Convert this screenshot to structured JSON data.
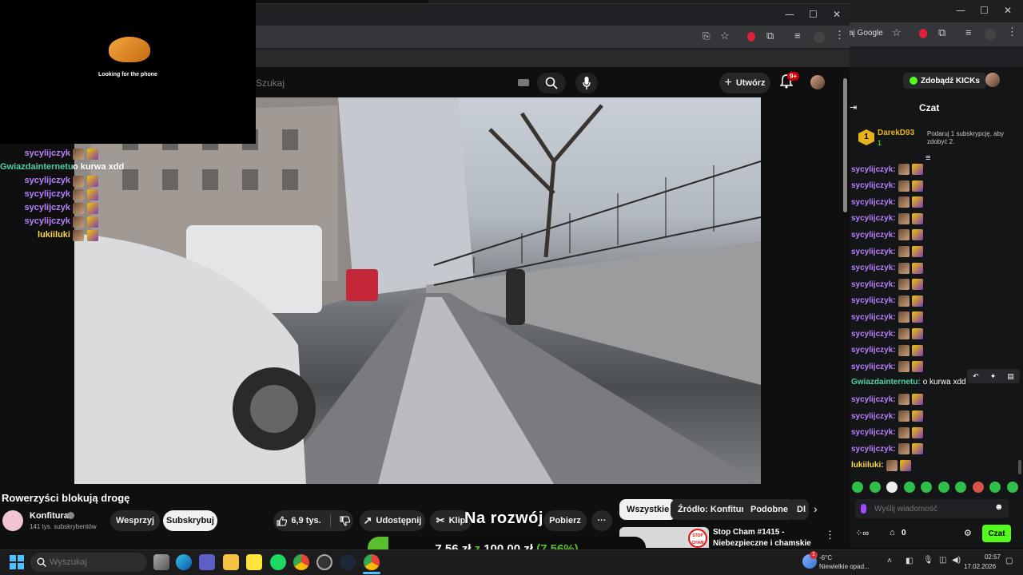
{
  "overlay": {
    "caption": "Looking for the phone"
  },
  "back_window": {
    "address_text": "aj Google"
  },
  "youtube": {
    "search_placeholder": "Szukaj",
    "create_label": "Utwórz",
    "notif_badge": "9+",
    "video_title": "Rowerzyści blokują drogę",
    "channel_name": "Konfitura",
    "subscribers": "141 tys. subskrybentów",
    "support_label": "Wesprzyj",
    "subscribe_label": "Subskrybuj",
    "like_count": "6,9 tys.",
    "share_label": "Udostępnij",
    "clip_label": "Klip",
    "download_label": "Pobierz",
    "filter_chips": [
      "Wszystkie",
      "Źródło: Konfitura",
      "Podobne",
      "Dl"
    ],
    "rec_title_1": "Stop Cham #1415 -",
    "rec_title_2": "Niebezpieczne i chamskie"
  },
  "stream_overlay": {
    "goal_label": "Na rozwój",
    "goal_amount": "7,56 zł",
    "goal_of": "z",
    "goal_target": "100,00 zł",
    "goal_percent": "(7.56%)",
    "goal_progress": 0.0756
  },
  "left_chat": [
    {
      "user": "sycylijczyk",
      "color": "#b980ff",
      "text": ""
    },
    {
      "user": "Gwiazdainternetu",
      "color": "#4fd1a5",
      "text": "o kurwa xdd"
    },
    {
      "user": "sycylijczyk",
      "color": "#b980ff",
      "text": ""
    },
    {
      "user": "sycylijczyk",
      "color": "#b980ff",
      "text": ""
    },
    {
      "user": "sycylijczyk",
      "color": "#b980ff",
      "text": ""
    },
    {
      "user": "sycylijczyk",
      "color": "#b980ff",
      "text": ""
    },
    {
      "user": "lukiiluki",
      "color": "#ffd84a",
      "text": ""
    }
  ],
  "kick": {
    "get_kicks_label": "Zdobądź KICKs",
    "chat_title": "Czat",
    "top_user": "DarekD93",
    "top_user_count": "1",
    "gift_note": "Podaruj 1 subskrypcję, aby zdobyć 2.",
    "messages": [
      {
        "user": "sycylijczyk:",
        "text": ""
      },
      {
        "user": "sycylijczyk:",
        "text": ""
      },
      {
        "user": "sycylijczyk:",
        "text": ""
      },
      {
        "user": "sycylijczyk:",
        "text": ""
      },
      {
        "user": "sycylijczyk:",
        "text": ""
      },
      {
        "user": "sycylijczyk:",
        "text": ""
      },
      {
        "user": "sycylijczyk:",
        "text": ""
      },
      {
        "user": "sycylijczyk:",
        "text": ""
      },
      {
        "user": "sycylijczyk:",
        "text": ""
      },
      {
        "user": "sycylijczyk:",
        "text": ""
      },
      {
        "user": "sycylijczyk:",
        "text": ""
      },
      {
        "user": "sycylijczyk:",
        "text": ""
      },
      {
        "user": "sycylijczyk:",
        "text": ""
      },
      {
        "user": "Gwiazdainternetu:",
        "text": "o kurwa xdd"
      },
      {
        "user": "sycylijczyk:",
        "text": ""
      },
      {
        "user": "sycylijczyk:",
        "text": ""
      },
      {
        "user": "sycylijczyk:",
        "text": ""
      },
      {
        "user": "sycylijczyk:",
        "text": ""
      },
      {
        "user": "lukiiluki:",
        "text": ""
      }
    ],
    "input_placeholder": "Wyślij wiadomość",
    "viewer_count": "0",
    "send_label": "Czat"
  },
  "taskbar": {
    "search_placeholder": "Wyszukaj",
    "weather_temp": "-6°C",
    "weather_desc": "Niewielkie opad...",
    "time": "02:57",
    "date": "17.02.2026",
    "weather_badge": "1"
  }
}
